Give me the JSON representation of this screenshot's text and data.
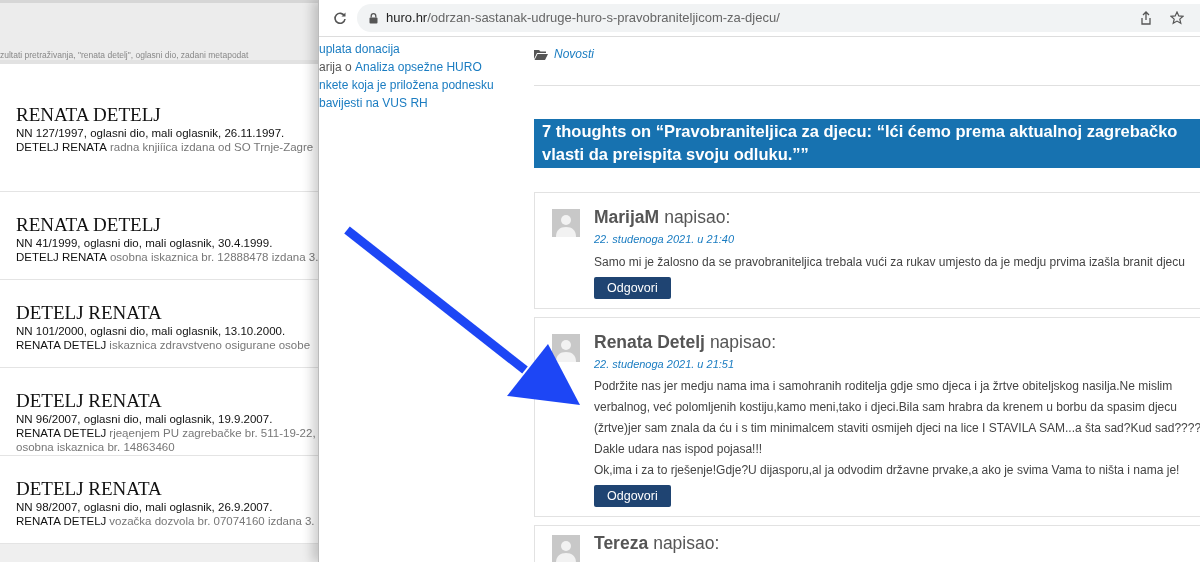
{
  "left_window": {
    "search_summary": "zultati pretraživanja, \"renata detelj\", oglasni dio, zadani metapodat",
    "results": [
      {
        "title": "RENATA DETELJ",
        "reference": "NN 127/1997, oglasni dio, mali oglasnik, 26.11.1997.",
        "name": "DETELJ RENATA",
        "details": [
          "radna knjiíica izdana od SO Trnje-Zagre"
        ]
      },
      {
        "title": "RENATA DETELJ",
        "reference": "NN 41/1999, oglasni dio, mali oglasnik, 30.4.1999.",
        "name": "DETELJ RENATA",
        "details": [
          "osobna iskaznica br. 12888478 izdana 3."
        ]
      },
      {
        "title": "DETELJ RENATA",
        "reference": "NN 101/2000, oglasni dio, mali oglasnik, 13.10.2000.",
        "name": "RENATA DETELJ",
        "details": [
          "iskaznica zdravstveno osigurane osobe"
        ]
      },
      {
        "title": "DETELJ RENATA",
        "reference": "NN 96/2007, oglasni dio, mali oglasnik, 19.9.2007.",
        "name": "RENATA DETELJ",
        "details": [
          "rjeąenjem PU zagrebačke br. 511-19-22,",
          "osobna iskaznica br. 14863460"
        ]
      },
      {
        "title": "DETELJ RENATA",
        "reference": "NN 98/2007, oglasni dio, mali oglasnik, 26.9.2007.",
        "name": "RENATA DETELJ",
        "details": [
          "vozačka dozvola br. 07074160 izdana 3."
        ]
      }
    ]
  },
  "browser": {
    "url_domain": "huro.hr",
    "url_path": "/odrzan-sastanak-udruge-huro-s-pravobraniteljicom-za-djecu/"
  },
  "sidebar": [
    {
      "kind": "link",
      "text": "uplata donacija"
    },
    {
      "kind": "mixed",
      "text": "arija o ",
      "link": "Analiza opsežne HURO"
    },
    {
      "kind": "link",
      "text": "nkete koja je priložena podnesku"
    },
    {
      "kind": "link",
      "text": "bavijesti na VUS RH"
    }
  ],
  "category": "Novosti",
  "comments_title": [
    "7 thoughts on “Pravobraniteljica za djecu: “Ići ćemo prema aktualnoj zagrebačko",
    "vlasti da preispita svoju odluku.””"
  ],
  "comments": [
    {
      "author": "MarijaM",
      "verb": "napisao:",
      "date": "22. studenoga 2021. u 21:40",
      "lines": [
        "Samo mi je žalosno da se pravobraniteljica trebala vući za rukav umjesto da je medju prvima izašla branit djecu"
      ],
      "reply": "Odgovori"
    },
    {
      "author": "Renata Detelj",
      "verb": "napisao:",
      "date": "22. studenoga 2021. u 21:51",
      "lines": [
        "Podržite nas jer medju nama ima i samohranih roditelja gdje smo djeca i ja žrtve obiteljskog nasilja.Ne mislim",
        "verbalnog, već polomljenih kostiju,kamo meni,tako i djeci.Bila sam hrabra da krenem u borbu da spasim djecu",
        "(žrtve)jer sam znala da ću i s tim minimalcem staviti osmijeh djeci na lice I STAVILA SAM...a šta sad?Kud sad????",
        "Dakle udara nas ispod pojasa!!!",
        "Ok,ima i za to rješenje!Gdje?U dijasporu,al ja odvodim državne prvake,a ako je svima Vama to ništa i nama je!"
      ],
      "reply": "Odgovori"
    },
    {
      "author": "Tereza",
      "verb": "napisao:"
    }
  ]
}
